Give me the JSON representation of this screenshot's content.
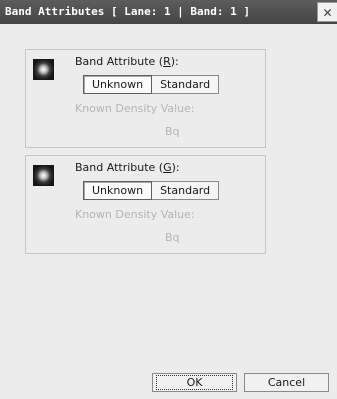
{
  "window": {
    "title": "Band Attributes [ Lane: 1 | Band: 1 ]",
    "close_glyph": "✕"
  },
  "groups": [
    {
      "label_prefix": "Band Attribute (",
      "mnemonic": "R",
      "label_suffix": "):",
      "options": [
        "Unknown",
        "Standard"
      ],
      "selected": "Unknown",
      "known_label": "Known Density Value:",
      "unit": "Bq"
    },
    {
      "label_prefix": "Band Attribute (",
      "mnemonic": "G",
      "label_suffix": "):",
      "options": [
        "Unknown",
        "Standard"
      ],
      "selected": "Unknown",
      "known_label": "Known Density Value:",
      "unit": "Bq"
    }
  ],
  "buttons": {
    "ok": "OK",
    "cancel": "Cancel"
  }
}
